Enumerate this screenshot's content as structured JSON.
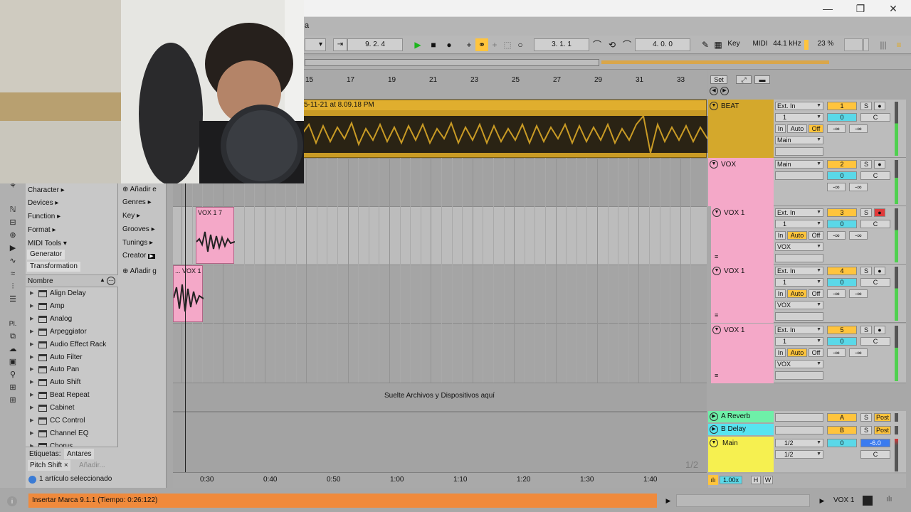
{
  "window": {
    "minimize": "—",
    "maximize": "❐",
    "close": "✕",
    "title_fragment": "a"
  },
  "transport": {
    "position": "9.  2.  4",
    "loop_start": "3.  1.  1",
    "loop_length": "4.  0.  0",
    "key": "Key",
    "midi": "MIDI",
    "sample_rate": "44.1 kHz",
    "cpu": "23 %"
  },
  "ruler": {
    "bars": [
      "15",
      "17",
      "19",
      "21",
      "23",
      "25",
      "27",
      "29",
      "31",
      "33"
    ],
    "set_label": "Set"
  },
  "timeline": {
    "times": [
      "0:30",
      "0:40",
      "0:50",
      "1:00",
      "1:10",
      "1:20",
      "1:30",
      "1:40"
    ],
    "page": "1/2",
    "zoom": "1.00x",
    "h": "H",
    "w": "W"
  },
  "browser": {
    "categories": [
      "Character ▸",
      "Devices ▸",
      "Function ▸",
      "Format ▸",
      "MIDI Tools ▾",
      "Generator",
      "Transformation"
    ],
    "secondary": [
      "Añadir e",
      "Genres ▸",
      "Key ▸",
      "Grooves ▸",
      "Tunings ▸",
      "Creator",
      "Añadir g"
    ],
    "name_header": "Nombre",
    "devices": [
      "Align Delay",
      "Amp",
      "Analog",
      "Arpeggiator",
      "Audio Effect Rack",
      "Auto Filter",
      "Auto Pan",
      "Auto Shift",
      "Beat Repeat",
      "Cabinet",
      "CC Control",
      "Channel EQ",
      "Chorus"
    ],
    "tags_label": "Etiquetas:",
    "tag_value": "Antares",
    "tag_chip": "Pitch Shift",
    "tag_add": "Añadir...",
    "selection": "1 artículo seleccionado"
  },
  "clips": {
    "beat": "5-11-21 at 8.09.18 PM",
    "vox17": "VOX 1 7",
    "vox1b": "... VOX 1"
  },
  "drop_text": "Suelte Archivos y Dispositivos aquí",
  "tracks": [
    {
      "name": "BEAT",
      "input": "Ext. In",
      "chan": "1",
      "number": "1",
      "vol": "0",
      "pan": "C",
      "route": "Main",
      "in": "In",
      "auto": "Auto",
      "off": "Off",
      "m1": "-∞",
      "m2": "-∞",
      "color": "#d4a82c"
    },
    {
      "name": "VOX",
      "input": "Main",
      "number": "2",
      "vol": "0",
      "pan": "C",
      "m1": "-∞",
      "m2": "-∞",
      "color": "#f4a8c8"
    },
    {
      "name": "VOX 1",
      "input": "Ext. In",
      "chan": "1",
      "number": "3",
      "vol": "0",
      "pan": "C",
      "route": "VOX",
      "in": "In",
      "auto": "Auto",
      "off": "Off",
      "m1": "-∞",
      "m2": "-∞",
      "color": "#f4a8c8"
    },
    {
      "name": "VOX 1",
      "input": "Ext. In",
      "chan": "1",
      "number": "4",
      "vol": "0",
      "pan": "C",
      "route": "VOX",
      "in": "In",
      "auto": "Auto",
      "off": "Off",
      "m1": "-∞",
      "m2": "-∞",
      "color": "#f4a8c8"
    },
    {
      "name": "VOX 1",
      "input": "Ext. In",
      "chan": "1",
      "number": "5",
      "vol": "0",
      "pan": "C",
      "route": "VOX",
      "in": "In",
      "auto": "Auto",
      "off": "Off",
      "m1": "-∞",
      "m2": "-∞",
      "color": "#f4a8c8"
    }
  ],
  "returns": [
    {
      "name": "A Reverb",
      "letter": "A",
      "post": "Post",
      "color": "#6ef0a8"
    },
    {
      "name": "B Delay",
      "letter": "B",
      "post": "Post",
      "color": "#58e4f0"
    }
  ],
  "main": {
    "name": "Main",
    "out1": "1/2",
    "out2": "1/2",
    "vol": "0",
    "db": "-6.0",
    "pan": "C",
    "color": "#f6f050"
  },
  "solo": "S",
  "status": {
    "message": "Insertar Marca 9.1.1 (Tiempo: 0:26:122)",
    "track": "VOX 1"
  },
  "colors": {
    "beat": "#d4a82c",
    "vox": "#f4a8c8",
    "orange": "#f08a3c",
    "yellow": "#ffc43d",
    "cyan": "#5ad8e8"
  }
}
